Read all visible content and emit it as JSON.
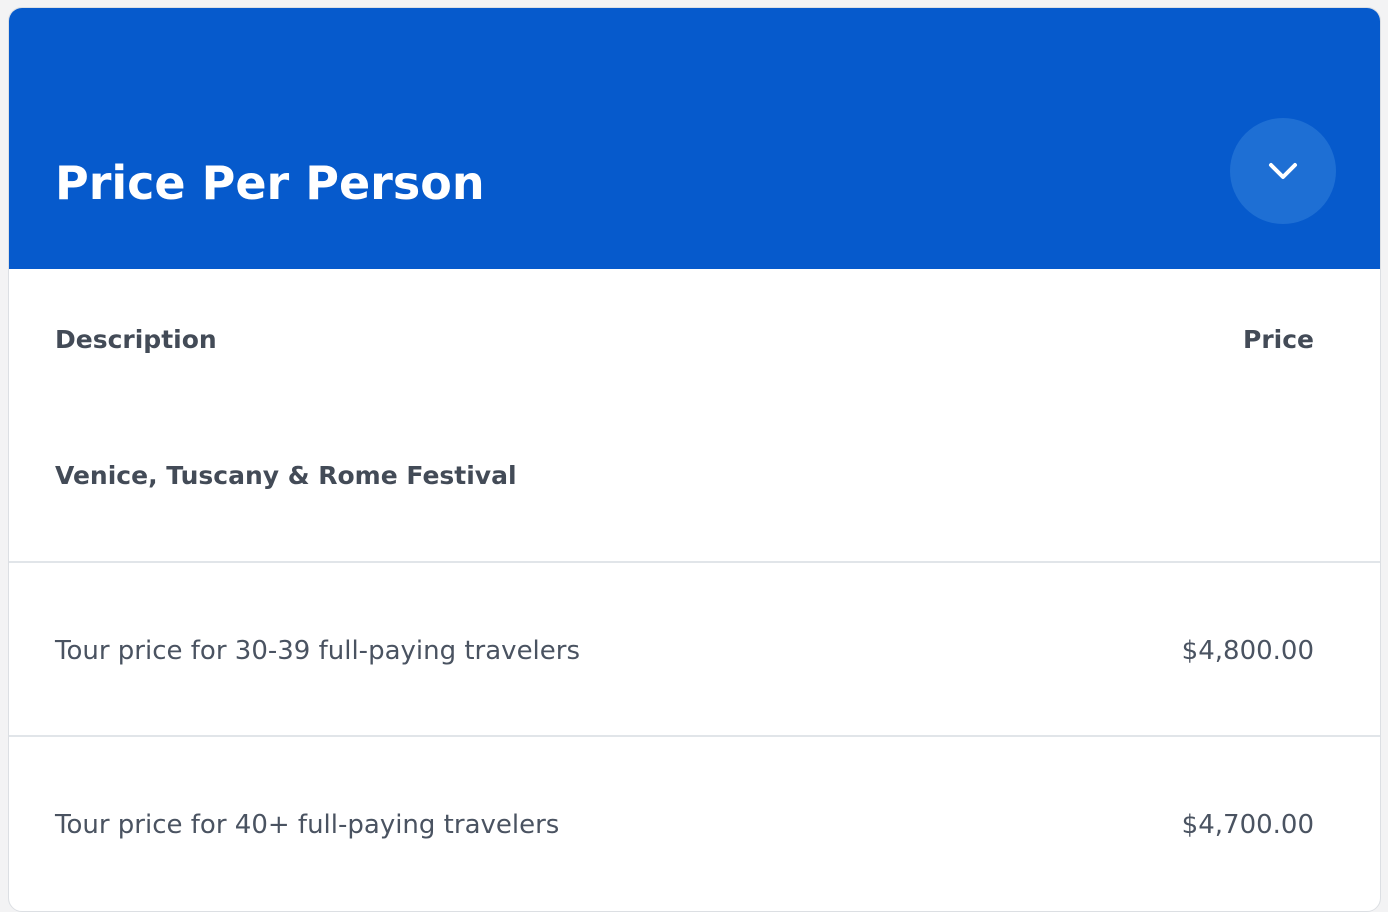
{
  "header": {
    "title": "Price Per Person",
    "toggle_icon": "chevron-down-icon"
  },
  "table": {
    "columns": [
      "Description",
      "Price"
    ],
    "group_title": "Venice, Tuscany & Rome Festival",
    "rows": [
      {
        "description": "Tour price for 30-39 full-paying travelers",
        "price": "$4,800.00"
      },
      {
        "description": "Tour price for 40+ full-paying travelers",
        "price": "$4,700.00"
      }
    ]
  },
  "colors": {
    "header_bg": "#065acc",
    "toggle_bg": "#1e6fd4",
    "text_dark": "#434b57",
    "divider": "#e1e5e9"
  }
}
